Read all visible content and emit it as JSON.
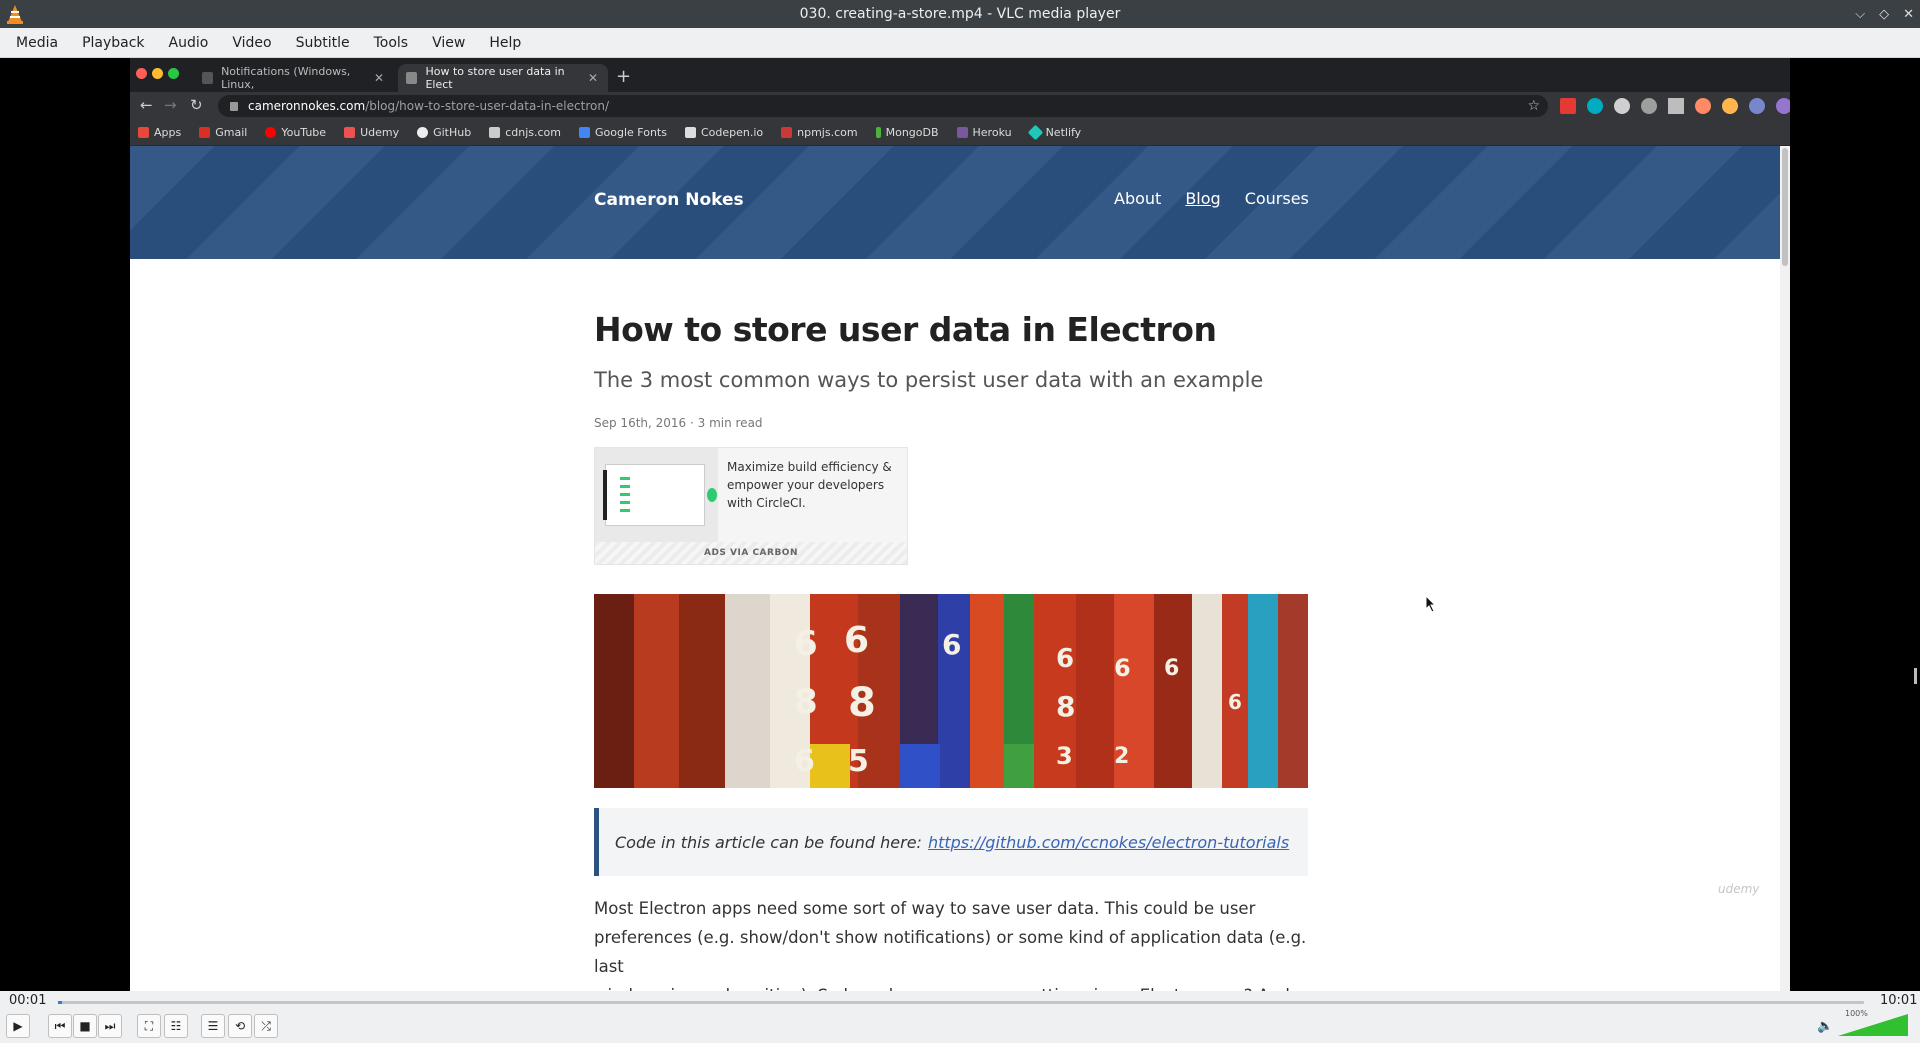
{
  "window": {
    "title": "030. creating-a-store.mp4 - VLC media player",
    "controls": [
      "⌵",
      "◇",
      "✕"
    ]
  },
  "menu": [
    "Media",
    "Playback",
    "Audio",
    "Video",
    "Subtitle",
    "Tools",
    "View",
    "Help"
  ],
  "browser": {
    "tabs": [
      {
        "label": "Notifications (Windows, Linux,",
        "active": false
      },
      {
        "label": "How to store user data in Elect",
        "active": true
      }
    ],
    "url_host": "cameronnokes.com",
    "url_path": "/blog/how-to-store-user-data-in-electron/",
    "bookmarks": [
      {
        "label": "Apps",
        "color": "#e8483b"
      },
      {
        "label": "Gmail",
        "color": "#d93025"
      },
      {
        "label": "YouTube",
        "color": "#ff0000"
      },
      {
        "label": "Udemy",
        "color": "#ec5252"
      },
      {
        "label": "GitHub",
        "color": "#eeeeee"
      },
      {
        "label": "cdnjs.com",
        "color": "#cccccc"
      },
      {
        "label": "Google Fonts",
        "color": "#4285f4"
      },
      {
        "label": "Codepen.io",
        "color": "#dddddd"
      },
      {
        "label": "npmjs.com",
        "color": "#cb3837"
      },
      {
        "label": "MongoDB",
        "color": "#4db33d"
      },
      {
        "label": "Heroku",
        "color": "#79589f"
      },
      {
        "label": "Netlify",
        "color": "#20c6b7"
      }
    ]
  },
  "site": {
    "name": "Cameron Nokes",
    "nav": [
      {
        "label": "About",
        "active": false
      },
      {
        "label": "Blog",
        "active": true
      },
      {
        "label": "Courses",
        "active": false
      }
    ]
  },
  "article": {
    "title": "How to store user data in Electron",
    "subtitle": "The 3 most common ways to persist user data with an example",
    "meta": "Sep 16th, 2016 · 3 min read",
    "ad_text": "Maximize build efficiency & empower your developers with CircleCI.",
    "ad_footer": "ADS VIA CARBON",
    "callout_text": "Code in this article can be found here:",
    "callout_link": "https://github.com/ccnokes/electron-tutorials",
    "body_lines": [
      "Most Electron apps need some sort of way to save user data. This could be user",
      "preferences (e.g. show/don't show notifications) or some kind of application data (e.g. last",
      "window size and position). So how do we save user settings in an Electron app? And where"
    ]
  },
  "watermark": "udemy",
  "player": {
    "elapsed": "00:01",
    "total": "10:01",
    "progress": 0.002,
    "volume_label": "100%",
    "volume": 1.0,
    "accent": "#3a7bd5"
  }
}
